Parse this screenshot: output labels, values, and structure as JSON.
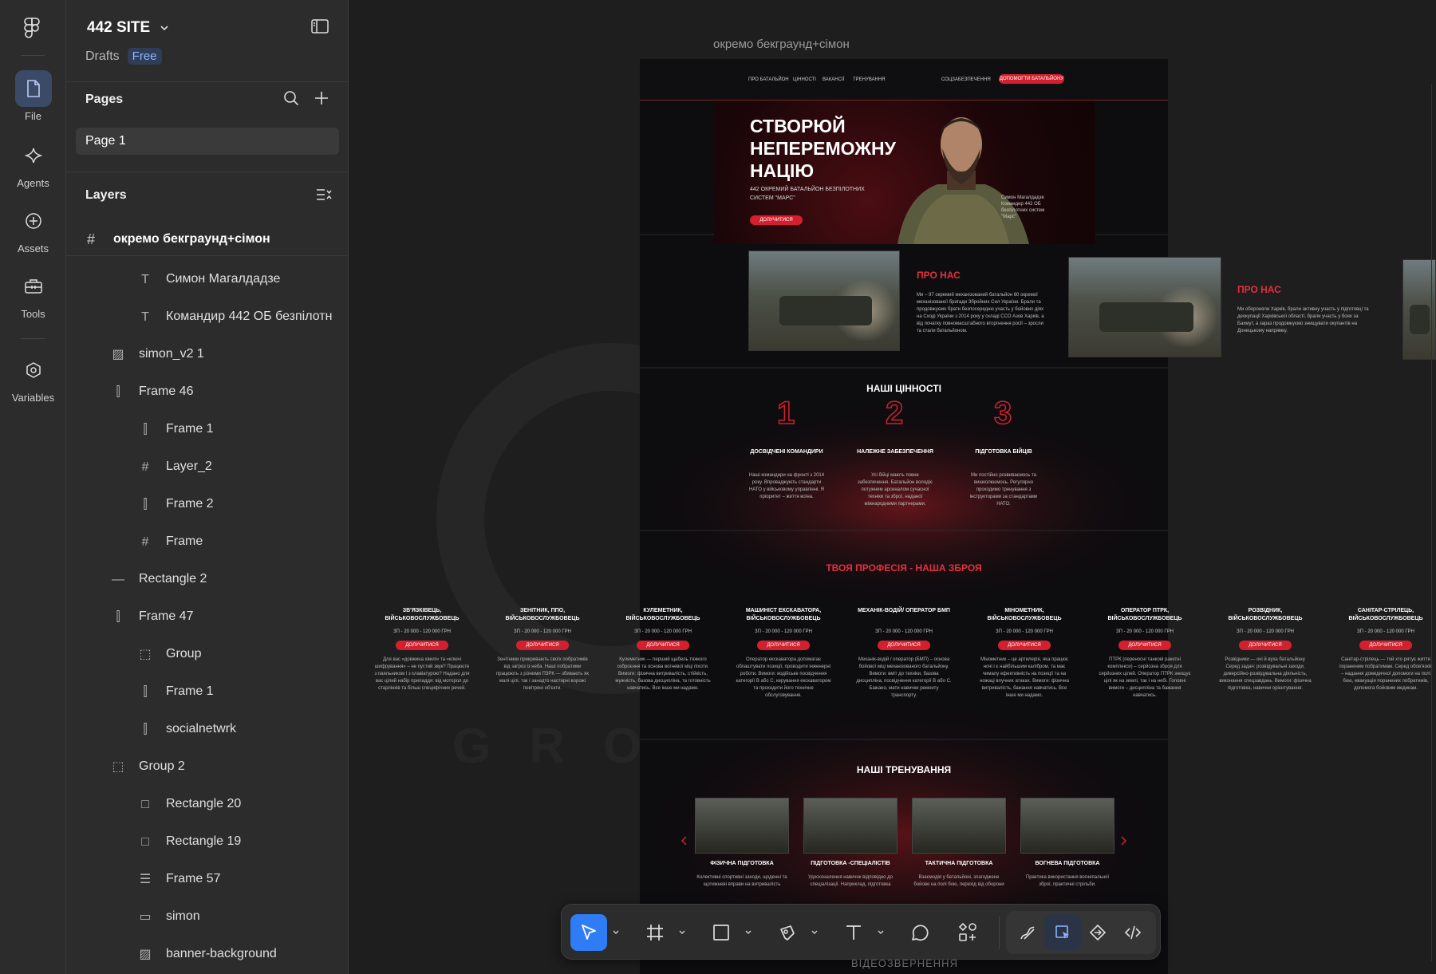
{
  "rail": {
    "items": [
      {
        "label": "File",
        "icon": "file-icon"
      },
      {
        "label": "Agents",
        "icon": "sparkle-icon"
      },
      {
        "label": "Assets",
        "icon": "plus-circle-icon"
      },
      {
        "label": "Tools",
        "icon": "toolbox-icon"
      },
      {
        "label": "Variables",
        "icon": "hexagon-icon"
      }
    ]
  },
  "panel": {
    "project_title": "442 SITE",
    "drafts_label": "Drafts",
    "plan_badge": "Free",
    "pages_title": "Pages",
    "current_page": "Page 1",
    "layers_title": "Layers",
    "top_frame": "окремо бекграунд+сімон",
    "layers": [
      {
        "name": "Симон Магалдадзе",
        "type": "text"
      },
      {
        "name": "Командир 442 ОБ безпілотн",
        "type": "text"
      },
      {
        "name": "simon_v2 1",
        "type": "image"
      },
      {
        "name": "Frame 46",
        "type": "autolayout-h"
      },
      {
        "name": "Frame 1",
        "type": "autolayout-h"
      },
      {
        "name": "Layer_2",
        "type": "frame"
      },
      {
        "name": "Frame 2",
        "type": "autolayout-h"
      },
      {
        "name": "Frame",
        "type": "frame"
      },
      {
        "name": "Rectangle 2",
        "type": "line"
      },
      {
        "name": "Frame 47",
        "type": "autolayout-h"
      },
      {
        "name": "Group",
        "type": "group"
      },
      {
        "name": "Frame 1",
        "type": "autolayout-h"
      },
      {
        "name": "socialnetwrk",
        "type": "autolayout-h"
      },
      {
        "name": "Group 2",
        "type": "group"
      },
      {
        "name": "Rectangle 20",
        "type": "rect"
      },
      {
        "name": "Rectangle 19",
        "type": "rect"
      },
      {
        "name": "Frame 57",
        "type": "autolayout-v"
      },
      {
        "name": "simon",
        "type": "rect-thin"
      },
      {
        "name": "banner-background",
        "type": "image"
      }
    ]
  },
  "canvas": {
    "frame_label": "окремо бекграунд+сімон",
    "bottom_label": "ВІДЕОЗВЕРНЕННЯ"
  },
  "site": {
    "nav": {
      "links": [
        "ПРО БАТАЛЬЙОН",
        "ЦІННОСТІ",
        "ВАКАНСІЇ",
        "ТРЕНУВАННЯ",
        "СОЦЗАБЕЗПЕЧЕННЯ"
      ],
      "cta": "ДОПОМОГТИ БАТАЛЬЙОНУ"
    },
    "hero": {
      "title": "СТВОРЮЙ НЕПЕРЕМОЖНУ НАЦІЮ",
      "subtitle": "442 ОКРЕМИЙ БАТАЛЬЙОН БЕЗПІЛОТНИХ СИСТЕМ \"МАРС\"",
      "button": "ДОЛУЧИТИСЯ",
      "person_caption": "Симон Магалдадзе Командир 442 ОБ безпілотних систем \"Марс\""
    },
    "about": {
      "title": "ПРО НАС",
      "text": "Ми – 97 окремий механізований батальйон 60 окремої механізованої бригади Збройних Сил України. Брали та продовжуємо брати безпосередню участь у бойових діях на Сході України з 2014 року у складі ССО Азов Харків, а від початку повномасштабного вторгнення росії – зросли та стали батальйоном.",
      "title2": "ПРО НАС",
      "text2": "Ми обороняли Харків, брали активну участь у підготовці та деокупації Харківської області, брали участь у боях за Бахмут, а зараз продовжуємо знищувати окупантів на Донецькому напрямку."
    },
    "values": {
      "title": "НАШІ ЦІННОСТІ",
      "items": [
        {
          "num": "1",
          "head": "ДОСВІДЧЕНІ КОМАНДИРИ",
          "text": "Наші командири на фронті з 2014 року. Впроваджують стандарти НАТО у військовому управлінні. Я пріоритет – життя воїна."
        },
        {
          "num": "2",
          "head": "НАЛЕЖНЕ ЗАБЕЗПЕЧЕННЯ",
          "text": "Усі бійці мають повне забезпечення. Батальйон володіє потужним арсеналом сучасної техніки та зброї, наданої міжнародними партнерами."
        },
        {
          "num": "3",
          "head": "ПІДГОТОВКА БІЙЦІВ",
          "text": "Ми постійно розвиваємось та вишколюємось. Регулярно проходимо тренування з інструкторами за стандартами НАТО."
        }
      ]
    },
    "professions": {
      "title": "ТВОЯ ПРОФЕСІЯ - НАША ЗБРОЯ",
      "pay": "ЗП - 20 000 - 120 000 ГРН",
      "button": "ДОЛУЧИТИСЯ",
      "items": [
        {
          "head": "ЗВ'ЯЗКІВЕЦЬ, ВІЙСЬКОВОСЛУЖБОВЕЦЬ",
          "text": "Для вас «довжина хвилі» та «ключі шифрування» – не пустий звук? Працюєте з паяльником і з клавіатурою? Надано для вас цілий набір приладдя: від моторол до старлінків та більш специфічних речей."
        },
        {
          "head": "ЗЕНІТНИК, ППО, ВІЙСЬКОВОСЛУЖБОВЕЦЬ",
          "text": "Зенітники прикривають своїх побратимів від загроз із неба. Наші побратими працюють з різними ПЗРК — збивають як малі цілі, так і занадто настирні ворожі повітряні об'єкти."
        },
        {
          "head": "КУЛЕМЕТНИК, ВІЙСЬКОВОСЛУЖБОВЕЦЬ",
          "text": "Кулеметник — перший щабель тяжкого озброєння та основа вогневої міці піхоти. Вимоги: фізична витривалість, стійкість, мужність, базова дисципліна, та готовність навчатись. Все інше ми надамо."
        },
        {
          "head": "МАШИНІСТ ЕКСКАВАТОРА, ВІЙСЬКОВОСЛУЖБОВЕЦЬ",
          "text": "Оператор екскаватора допомагає облаштувати позиції, проводити інженерні роботи. Вимоги: водійське посвідчення категорії В або С, керування екскаватором та проходити його технічне обслуговування."
        },
        {
          "head": "МЕХАНІК-ВОДІЙ/ ОПЕРАТОР БМП",
          "text": "Механік-водій / оператор (БМП) – основа бойової міці механізованого батальйону. Вимоги: вміт до техніки, базова дисципліна, посвідчення категорії В або С. Бажано, мати навички ремонту транспорту."
        },
        {
          "head": "МІНОМЕТНИК, ВІЙСЬКОВОСЛУЖБОВЕЦЬ",
          "text": "Мінометник – це артилерія, яка працює ночі і є найбільшим калібром, та має чималу ефективність на позиції та на ножаці влучних атаках. Вимоги: фізична витривалість, бажання навчатись. Все інше ми надамо."
        },
        {
          "head": "ОПЕРАТОР ПТРК, ВІЙСЬКОВОСЛУЖБОВЕЦЬ",
          "text": "ПТРК (переносні танкові ракетні комплекси) – серйозна зброя для серйозних цілей. Оператор ПТРК знищує цілі як на землі, так і на небі. Головні вимоги – дисципліна та бажання навчатись."
        },
        {
          "head": "РОЗВІДНИК, ВІЙСЬКОВОСЛУЖБОВЕЦЬ",
          "text": "Розвідники — очі й вуха батальйону. Серед задач: розвідувальні заходи, диверсійно-розвідувальна діяльність, виконання спецзавдань. Вимоги: фізична підготовка, навички орієнтування."
        },
        {
          "head": "САНІТАР-СТРІЛЕЦЬ, ВІЙСЬКОВОСЛУЖБОВЕЦЬ",
          "text": "Санітар-стрілець — той хто рятує життя пораненим побратимам. Серед обов'язків – надання домедичної допомоги на полі бою, евакуація поранених побратимів, допомога бойовим медикам."
        }
      ]
    },
    "training": {
      "title": "НАШІ ТРЕНУВАННЯ",
      "items": [
        {
          "head": "ФІЗИЧНА ПІДГОТОВКА",
          "text": "Колективні спортивні заходи, щоденні та щотижневі вправи на витривалість"
        },
        {
          "head": "ПІДГОТОВКА -СПЕЦІАЛІСТІВ",
          "text": "Удосконалення навичок відповідно до спеціалізації. Наприклад, підготовка"
        },
        {
          "head": "ТАКТИЧНА ПІДГОТОВКА",
          "text": "Взаємодія у батальйоні, злагоджене бойове на полі бою, перехід від оборони"
        },
        {
          "head": "ВОГНЕВА ПІДГОТОВКА",
          "text": "Практика використання вогнепальної зброї, практичні стрільби."
        }
      ]
    }
  },
  "colors": {
    "accent_red": "#d4202e",
    "selection_blue": "#2f7df6",
    "panel_bg": "#2c2c2c",
    "canvas_bg": "#1e1e1e"
  },
  "toolbar": {
    "tools": [
      "move-tool",
      "frame-tool",
      "rectangle-tool",
      "pen-tool",
      "text-tool",
      "comment-tool",
      "components-tool"
    ],
    "modes": [
      "draw-mode",
      "design-mode",
      "prototype-mode",
      "dev-mode"
    ]
  }
}
